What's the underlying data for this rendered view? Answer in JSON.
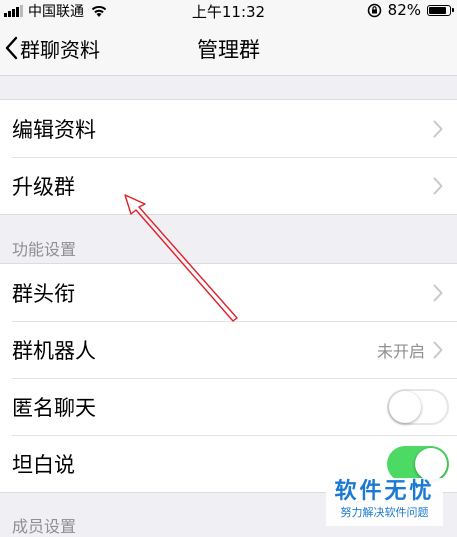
{
  "status_bar": {
    "carrier": "中国联通",
    "time": "上午11:32",
    "battery": "82%"
  },
  "nav": {
    "back_label": "群聊资料",
    "title": "管理群"
  },
  "group1": {
    "items": [
      {
        "label": "编辑资料"
      },
      {
        "label": "升级群"
      }
    ]
  },
  "features": {
    "header": "功能设置",
    "items": [
      {
        "label": "群头衔"
      },
      {
        "label": "群机器人",
        "value": "未开启"
      },
      {
        "label": "匿名聊天",
        "toggle": "off"
      },
      {
        "label": "坦白说",
        "toggle": "on"
      }
    ]
  },
  "members": {
    "header": "成员设置"
  },
  "watermark": {
    "main": "软件无忧",
    "sub": "努力解决软件问题"
  },
  "colors": {
    "toggle_on": "#4cd964",
    "annotation_arrow": "#e0202a",
    "watermark": "#1b79d4"
  },
  "icons": [
    "wifi-icon",
    "orientation-lock-icon",
    "battery-icon",
    "back-chevron-icon",
    "chevron-right-icon"
  ]
}
